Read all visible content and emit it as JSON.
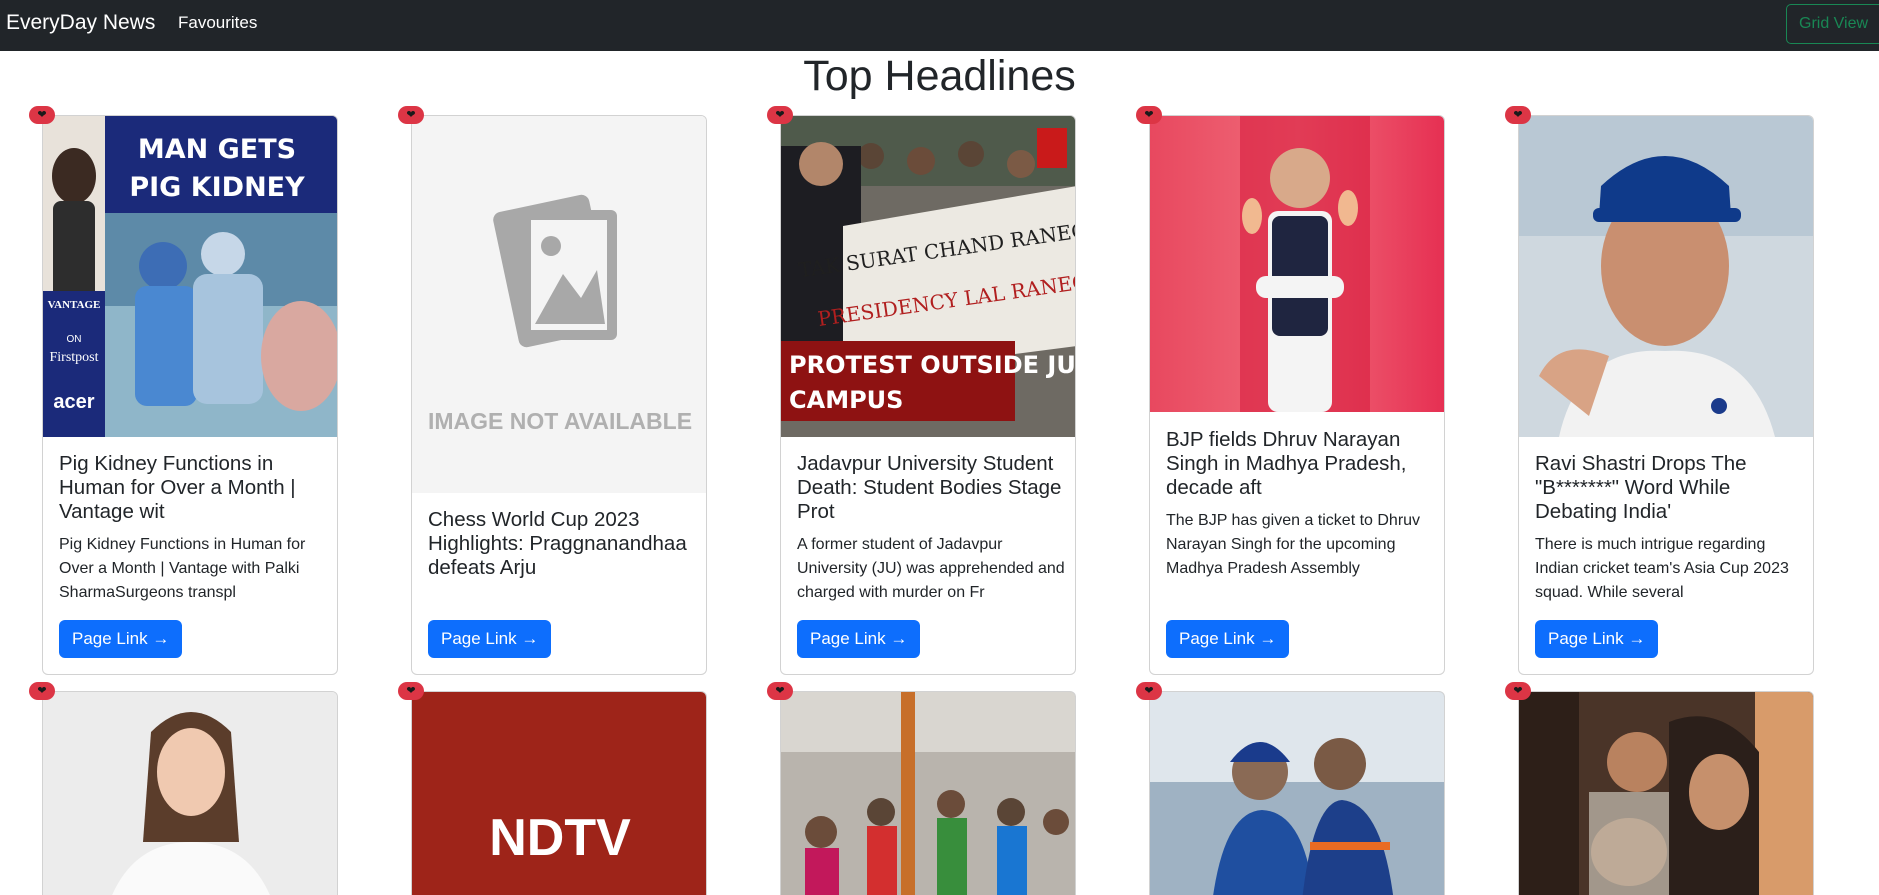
{
  "navbar": {
    "brand": "EveryDay News",
    "favourites": "Favourites",
    "grid_view": "Grid View"
  },
  "page_title": "Top Headlines",
  "fav_icon": "heart-icon",
  "cards": [
    {
      "title": "Pig Kidney Functions in Human for Over a Month | Vantage wit",
      "description": "Pig Kidney Functions in Human for Over a Month | Vantage with Palki SharmaSurgeons transpl",
      "link_label": "Page Link →",
      "image_text_1": "MAN GETS",
      "image_text_2": "PIG KIDNEY",
      "image_side_1": "VANTAGE",
      "image_side_2": "ON",
      "image_side_3": "Firstpost",
      "image_side_4": "acer"
    },
    {
      "title": "Chess World Cup 2023 Highlights: Praggnanandhaa defeats Arju",
      "description": "",
      "link_label": "Page Link →",
      "image_text_1": "IMAGE NOT AVAILABLE"
    },
    {
      "title": "Jadavpur University Student Death: Student Bodies Stage Prot",
      "description": "A former student of Jadavpur University (JU) was apprehended and charged with murder on Fr",
      "link_label": "Page Link →",
      "image_text_1": "PROTEST OUTSIDE JU",
      "image_text_2": "CAMPUS"
    },
    {
      "title": "BJP fields Dhruv Narayan Singh in Madhya Pradesh, decade aft",
      "description": "The BJP has given a ticket to Dhruv Narayan Singh for the upcoming Madhya Pradesh Assembly",
      "link_label": "Page Link →"
    },
    {
      "title": "Ravi Shastri Drops The \"B*******\" Word While Debating India'",
      "description": "There is much intrigue regarding Indian cricket team's Asia Cup 2023 squad. While several",
      "link_label": "Page Link →"
    }
  ],
  "row2": [
    {
      "image": "woman-portrait"
    },
    {
      "image": "ndtv-logo",
      "image_text_1": "NDTV"
    },
    {
      "image": "group-photo"
    },
    {
      "image": "cricket-players"
    },
    {
      "image": "family-photo"
    }
  ]
}
